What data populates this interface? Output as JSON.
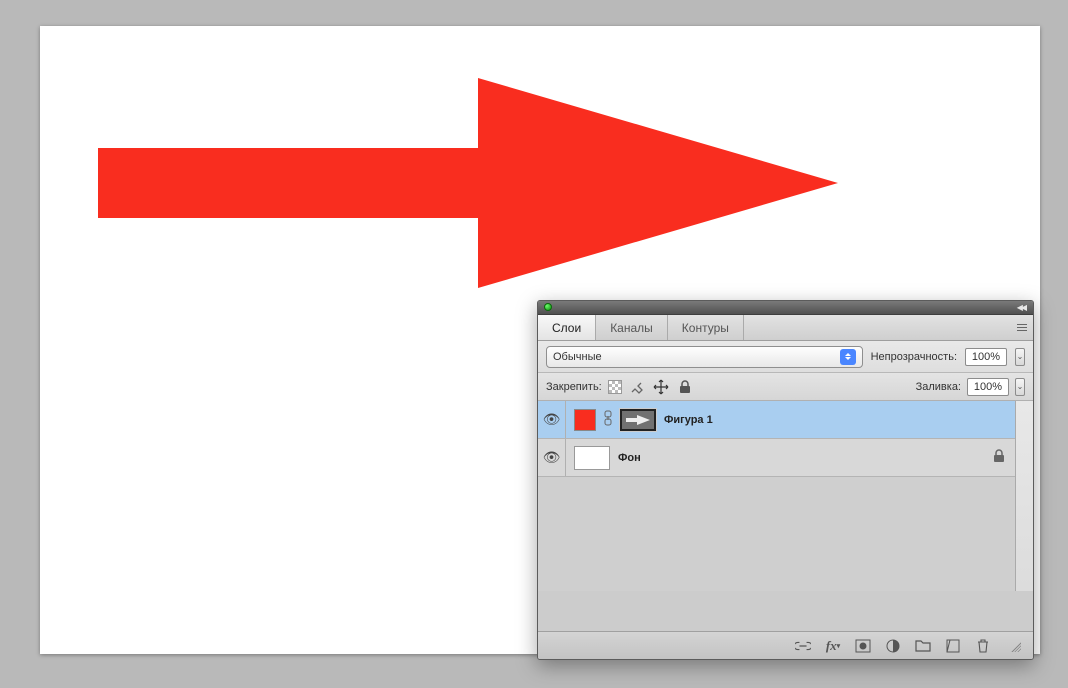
{
  "canvas": {
    "shape_color": "#f92d1f"
  },
  "panel": {
    "tabs": [
      {
        "id": "layers",
        "label": "Слои",
        "active": true
      },
      {
        "id": "channels",
        "label": "Каналы",
        "active": false
      },
      {
        "id": "paths",
        "label": "Контуры",
        "active": false
      }
    ],
    "blend_mode": "Обычные",
    "opacity_label": "Непрозрачность:",
    "opacity_value": "100%",
    "lock_label": "Закрепить:",
    "fill_label": "Заливка:",
    "fill_value": "100%",
    "layers": [
      {
        "name": "Фигура 1",
        "selected": true,
        "fill": "#f92d1f",
        "is_shape": true
      },
      {
        "name": "Фон",
        "selected": false,
        "is_bg": true,
        "locked": true
      }
    ]
  }
}
